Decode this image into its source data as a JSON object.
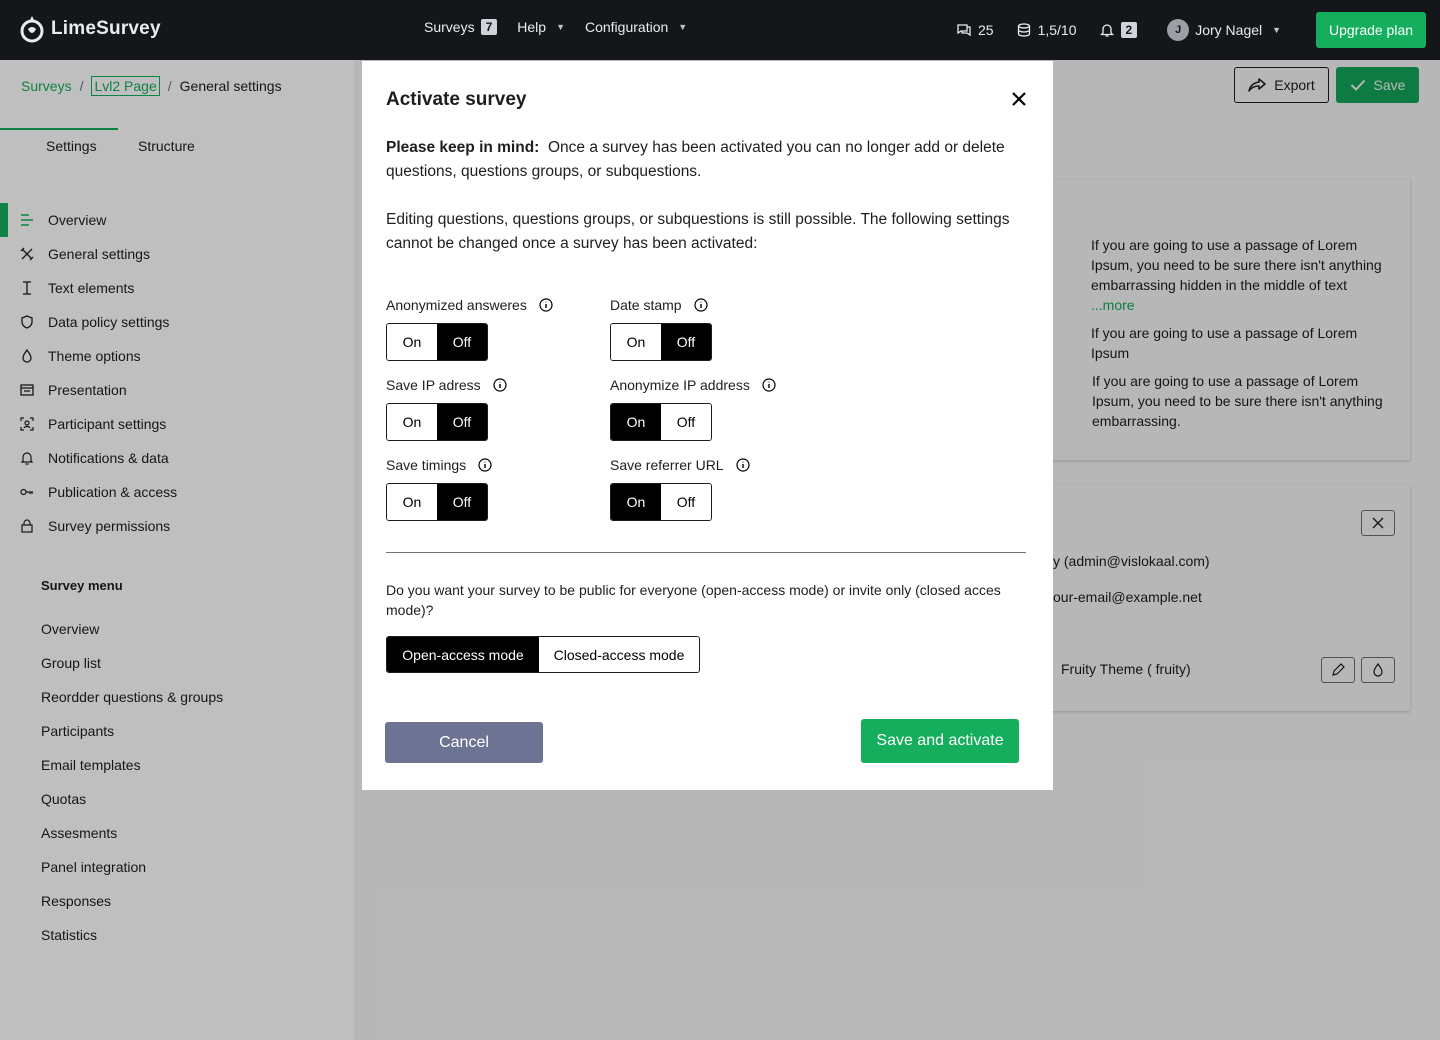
{
  "brand": {
    "name": "LimeSurvey",
    "accent": "#14ae5c",
    "nav_bg": "#14161a"
  },
  "topnav": {
    "surveys": {
      "label": "Surveys",
      "badge": "7"
    },
    "help": {
      "label": "Help"
    },
    "configuration": {
      "label": "Configuration"
    },
    "messages_count": "25",
    "storage": "1,5/10",
    "notifications_count": "2",
    "user": {
      "initial": "J",
      "name": "Jory Nagel"
    },
    "upgrade_label": "Upgrade plan"
  },
  "breadcrumb": {
    "item1": "Surveys",
    "sep": "/",
    "item2": "Lvl2 Page",
    "item3": "General settings"
  },
  "header_actions": {
    "export": "Export",
    "save": "Save"
  },
  "tabs": {
    "settings": "Settings",
    "structure": "Structure"
  },
  "sidebar": {
    "items": [
      {
        "label": "Overview",
        "icon": "overview-icon"
      },
      {
        "label": "General settings",
        "icon": "tools-icon"
      },
      {
        "label": "Text elements",
        "icon": "text-cursor-icon"
      },
      {
        "label": "Data policy settings",
        "icon": "shield-icon"
      },
      {
        "label": "Theme options",
        "icon": "drop-icon"
      },
      {
        "label": "Presentation",
        "icon": "presentation-icon"
      },
      {
        "label": "Participant settings",
        "icon": "participant-icon"
      },
      {
        "label": "Notifications & data",
        "icon": "bell-icon"
      },
      {
        "label": "Publication  & access",
        "icon": "key-icon"
      },
      {
        "label": "Survey permissions",
        "icon": "lock-icon"
      }
    ],
    "menu_title": "Survey menu",
    "menu": [
      "Overview",
      "Group list",
      "Reordder questions & groups",
      "Participants",
      "Email templates",
      "Quotas",
      "Assesments",
      "Panel integration",
      "Responses",
      "Statistics"
    ]
  },
  "content": {
    "card1": {
      "p1": "If you are going to use a passage of Lorem Ipsum, you need to be sure there isn't anything embarrassing hidden in the middle of text",
      "p1_more": "...more",
      "p2": "If you are going to use a passage of Lorem Ipsum",
      "p3": "If you are going to use a passage of Lorem Ipsum, you need to be sure there isn't anything embarrassing."
    },
    "card2": {
      "admin": "y (admin@vislokaal.com)",
      "email": "our-email@example.net",
      "theme": "Fruity Theme ( fruity)"
    }
  },
  "modal": {
    "title": "Activate survey",
    "keep_in_mind_label": "Please keep in mind:",
    "keep_in_mind_text": "Once a survey has been activated you can no longer add or delete questions, questions groups, or subquestions.",
    "editing_text": "Editing questions, questions groups, or subquestions is still possible. The following settings cannot be changed once a survey has been activated:",
    "on_label": "On",
    "off_label": "Off",
    "settings": [
      {
        "label": "Anonymized answeres",
        "value": "Off"
      },
      {
        "label": "Date stamp",
        "value": "Off"
      },
      {
        "label": "Save IP adress",
        "value": "Off"
      },
      {
        "label": "Anonymize IP address",
        "value": "On"
      },
      {
        "label": "Save timings",
        "value": "Off"
      },
      {
        "label": "Save referrer URL",
        "value": "On"
      }
    ],
    "access_question": "Do you want your survey to be public for everyone (open-access mode) or invite only (closed acces mode)?",
    "access_modes": {
      "open": "Open-access mode",
      "closed": "Closed-access mode",
      "selected": "Open-access mode"
    },
    "cancel": "Cancel",
    "save_activate": "Save and activate"
  }
}
